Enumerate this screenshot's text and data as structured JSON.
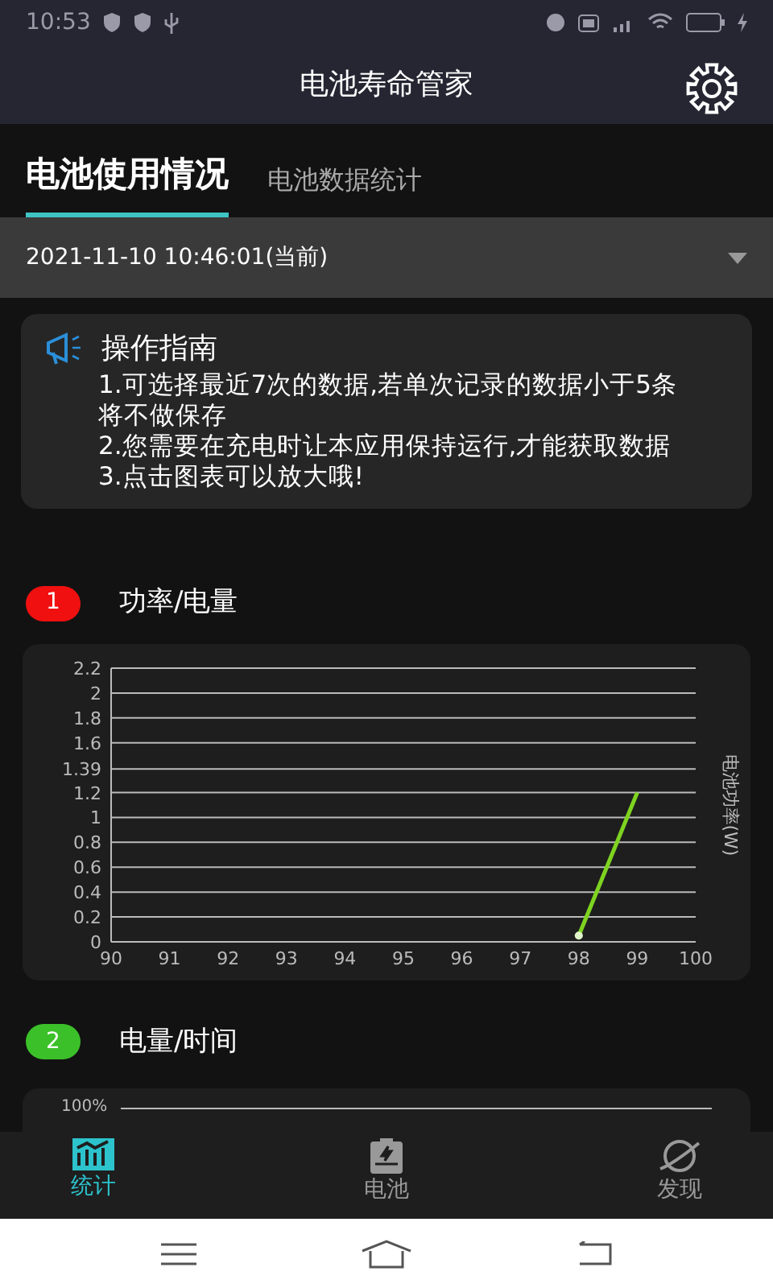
{
  "status_bar": {
    "time": "10:53"
  },
  "app_bar": {
    "title": "电池寿命管家"
  },
  "tabs": [
    {
      "label": "电池使用情况",
      "selected": true
    },
    {
      "label": "电池数据统计",
      "selected": false
    }
  ],
  "record_select": {
    "value": "2021-11-10 10:46:01(当前)"
  },
  "guide": {
    "title": "操作指南",
    "lines": [
      "1.可选择最近7次的数据,若单次记录的数据小于5条将不做保存",
      "2.您需要在充电时让本应用保持运行,才能获取数据",
      "3.点击图表可以放大哦!"
    ]
  },
  "sections": [
    {
      "number": "1",
      "title": "功率/电量",
      "color": "#f01010",
      "chart_data": {
        "type": "line",
        "grid": true,
        "ylabel": "电池功率(W)",
        "x": [
          98,
          99
        ],
        "series": [
          {
            "color": "#7ed321",
            "values": [
              0.05,
              1.2
            ]
          }
        ],
        "xlim": [
          90,
          100
        ],
        "ylim": [
          0,
          2.2
        ],
        "xticks": [
          90,
          91,
          92,
          93,
          94,
          95,
          96,
          97,
          98,
          99,
          100
        ],
        "yticks": [
          0,
          0.2,
          0.4,
          0.6,
          0.8,
          1,
          1.2,
          1.39,
          1.6,
          1.8,
          2,
          2.2
        ]
      }
    },
    {
      "number": "2",
      "title": "电量/时间",
      "color": "#3cc02a",
      "chart_top_label": "100%"
    }
  ],
  "bottom_nav": [
    {
      "label": "统计",
      "selected": true,
      "kind": "chart"
    },
    {
      "label": "电池",
      "selected": false,
      "kind": "battery"
    },
    {
      "label": "发现",
      "selected": false,
      "kind": "planet"
    }
  ]
}
